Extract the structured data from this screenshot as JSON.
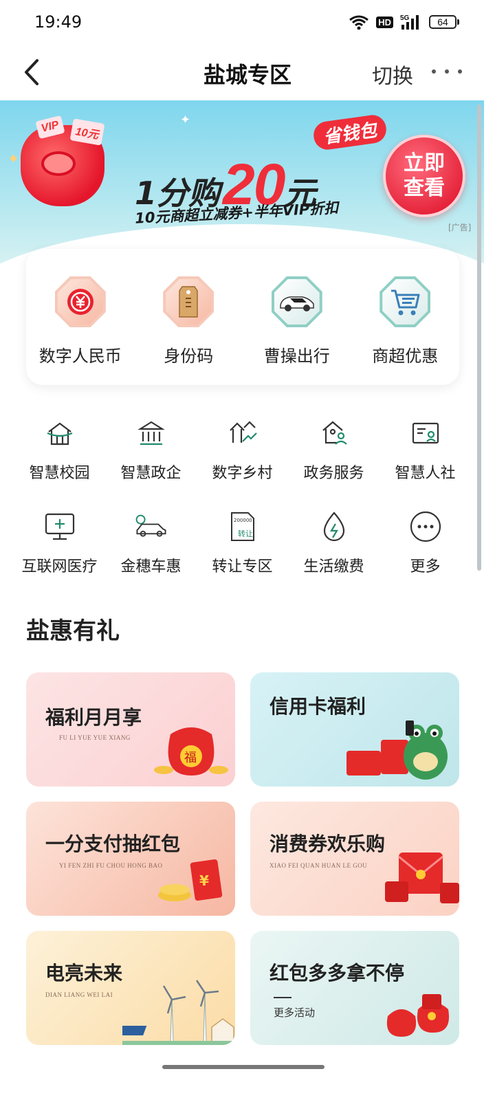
{
  "status_bar": {
    "time": "19:49",
    "network": "5G",
    "hd": "HD",
    "battery": "64"
  },
  "nav": {
    "title": "盐城专区",
    "switch_label": "切换"
  },
  "banner": {
    "ticket_vip": "VIP",
    "ticket_value": "10元",
    "tag": "省钱包",
    "headline_prefix": "1分购",
    "headline_amount": "20",
    "headline_suffix": "元",
    "subline": "10元商超立减券+半年VIP折扣",
    "cta_line1": "立即",
    "cta_line2": "查看",
    "ad_label": "[广告]"
  },
  "featured": [
    {
      "label": "数字人民币",
      "icon": "digital-rmb-icon"
    },
    {
      "label": "身份码",
      "icon": "id-code-icon"
    },
    {
      "label": "曹操出行",
      "icon": "car-ride-icon"
    },
    {
      "label": "商超优惠",
      "icon": "shopping-cart-icon"
    }
  ],
  "services": [
    {
      "label": "智慧校园",
      "icon": "campus-icon"
    },
    {
      "label": "智慧政企",
      "icon": "government-icon"
    },
    {
      "label": "数字乡村",
      "icon": "village-icon"
    },
    {
      "label": "政务服务",
      "icon": "gov-service-icon"
    },
    {
      "label": "智慧人社",
      "icon": "social-security-icon"
    },
    {
      "label": "互联网医疗",
      "icon": "medical-icon"
    },
    {
      "label": "金穗车惠",
      "icon": "car-icon"
    },
    {
      "label": "转让专区",
      "icon": "transfer-icon"
    },
    {
      "label": "生活缴费",
      "icon": "utility-icon"
    },
    {
      "label": "更多",
      "icon": "more-icon"
    }
  ],
  "transfer_icon_text": {
    "top": "200000",
    "bottom": "转让"
  },
  "section": {
    "title": "盐惠有礼"
  },
  "promos": [
    {
      "title": "福利月月享",
      "pinyin": "FU LI YUE YUE XIANG"
    },
    {
      "title": "信用卡福利",
      "pinyin": ""
    },
    {
      "title": "一分支付抽红包",
      "pinyin": "YI FEN ZHI FU CHOU HONG BAO"
    },
    {
      "title": "消费券欢乐购",
      "pinyin": "XIAO FEI QUAN HUAN LE GOU"
    },
    {
      "title": "电亮未来",
      "pinyin": "DIAN LIANG WEI LAI"
    },
    {
      "title": "红包多多拿不停",
      "pinyin": "",
      "extra": "更多活动"
    }
  ],
  "colors": {
    "accent_green": "#1f8a6d",
    "brand_red": "#ef2e3a"
  }
}
